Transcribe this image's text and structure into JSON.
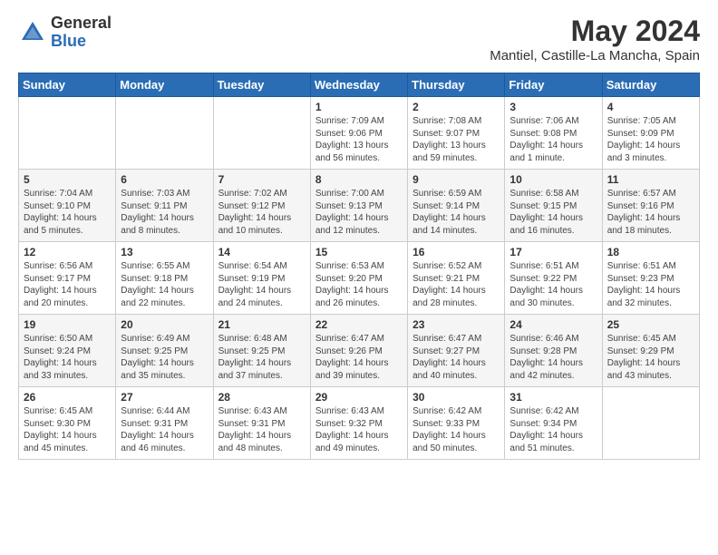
{
  "header": {
    "logo_general": "General",
    "logo_blue": "Blue",
    "main_title": "May 2024",
    "subtitle": "Mantiel, Castille-La Mancha, Spain"
  },
  "columns": [
    "Sunday",
    "Monday",
    "Tuesday",
    "Wednesday",
    "Thursday",
    "Friday",
    "Saturday"
  ],
  "weeks": [
    [
      {
        "day": "",
        "sunrise": "",
        "sunset": "",
        "daylight": ""
      },
      {
        "day": "",
        "sunrise": "",
        "sunset": "",
        "daylight": ""
      },
      {
        "day": "",
        "sunrise": "",
        "sunset": "",
        "daylight": ""
      },
      {
        "day": "1",
        "sunrise": "Sunrise: 7:09 AM",
        "sunset": "Sunset: 9:06 PM",
        "daylight": "Daylight: 13 hours and 56 minutes."
      },
      {
        "day": "2",
        "sunrise": "Sunrise: 7:08 AM",
        "sunset": "Sunset: 9:07 PM",
        "daylight": "Daylight: 13 hours and 59 minutes."
      },
      {
        "day": "3",
        "sunrise": "Sunrise: 7:06 AM",
        "sunset": "Sunset: 9:08 PM",
        "daylight": "Daylight: 14 hours and 1 minute."
      },
      {
        "day": "4",
        "sunrise": "Sunrise: 7:05 AM",
        "sunset": "Sunset: 9:09 PM",
        "daylight": "Daylight: 14 hours and 3 minutes."
      }
    ],
    [
      {
        "day": "5",
        "sunrise": "Sunrise: 7:04 AM",
        "sunset": "Sunset: 9:10 PM",
        "daylight": "Daylight: 14 hours and 5 minutes."
      },
      {
        "day": "6",
        "sunrise": "Sunrise: 7:03 AM",
        "sunset": "Sunset: 9:11 PM",
        "daylight": "Daylight: 14 hours and 8 minutes."
      },
      {
        "day": "7",
        "sunrise": "Sunrise: 7:02 AM",
        "sunset": "Sunset: 9:12 PM",
        "daylight": "Daylight: 14 hours and 10 minutes."
      },
      {
        "day": "8",
        "sunrise": "Sunrise: 7:00 AM",
        "sunset": "Sunset: 9:13 PM",
        "daylight": "Daylight: 14 hours and 12 minutes."
      },
      {
        "day": "9",
        "sunrise": "Sunrise: 6:59 AM",
        "sunset": "Sunset: 9:14 PM",
        "daylight": "Daylight: 14 hours and 14 minutes."
      },
      {
        "day": "10",
        "sunrise": "Sunrise: 6:58 AM",
        "sunset": "Sunset: 9:15 PM",
        "daylight": "Daylight: 14 hours and 16 minutes."
      },
      {
        "day": "11",
        "sunrise": "Sunrise: 6:57 AM",
        "sunset": "Sunset: 9:16 PM",
        "daylight": "Daylight: 14 hours and 18 minutes."
      }
    ],
    [
      {
        "day": "12",
        "sunrise": "Sunrise: 6:56 AM",
        "sunset": "Sunset: 9:17 PM",
        "daylight": "Daylight: 14 hours and 20 minutes."
      },
      {
        "day": "13",
        "sunrise": "Sunrise: 6:55 AM",
        "sunset": "Sunset: 9:18 PM",
        "daylight": "Daylight: 14 hours and 22 minutes."
      },
      {
        "day": "14",
        "sunrise": "Sunrise: 6:54 AM",
        "sunset": "Sunset: 9:19 PM",
        "daylight": "Daylight: 14 hours and 24 minutes."
      },
      {
        "day": "15",
        "sunrise": "Sunrise: 6:53 AM",
        "sunset": "Sunset: 9:20 PM",
        "daylight": "Daylight: 14 hours and 26 minutes."
      },
      {
        "day": "16",
        "sunrise": "Sunrise: 6:52 AM",
        "sunset": "Sunset: 9:21 PM",
        "daylight": "Daylight: 14 hours and 28 minutes."
      },
      {
        "day": "17",
        "sunrise": "Sunrise: 6:51 AM",
        "sunset": "Sunset: 9:22 PM",
        "daylight": "Daylight: 14 hours and 30 minutes."
      },
      {
        "day": "18",
        "sunrise": "Sunrise: 6:51 AM",
        "sunset": "Sunset: 9:23 PM",
        "daylight": "Daylight: 14 hours and 32 minutes."
      }
    ],
    [
      {
        "day": "19",
        "sunrise": "Sunrise: 6:50 AM",
        "sunset": "Sunset: 9:24 PM",
        "daylight": "Daylight: 14 hours and 33 minutes."
      },
      {
        "day": "20",
        "sunrise": "Sunrise: 6:49 AM",
        "sunset": "Sunset: 9:25 PM",
        "daylight": "Daylight: 14 hours and 35 minutes."
      },
      {
        "day": "21",
        "sunrise": "Sunrise: 6:48 AM",
        "sunset": "Sunset: 9:25 PM",
        "daylight": "Daylight: 14 hours and 37 minutes."
      },
      {
        "day": "22",
        "sunrise": "Sunrise: 6:47 AM",
        "sunset": "Sunset: 9:26 PM",
        "daylight": "Daylight: 14 hours and 39 minutes."
      },
      {
        "day": "23",
        "sunrise": "Sunrise: 6:47 AM",
        "sunset": "Sunset: 9:27 PM",
        "daylight": "Daylight: 14 hours and 40 minutes."
      },
      {
        "day": "24",
        "sunrise": "Sunrise: 6:46 AM",
        "sunset": "Sunset: 9:28 PM",
        "daylight": "Daylight: 14 hours and 42 minutes."
      },
      {
        "day": "25",
        "sunrise": "Sunrise: 6:45 AM",
        "sunset": "Sunset: 9:29 PM",
        "daylight": "Daylight: 14 hours and 43 minutes."
      }
    ],
    [
      {
        "day": "26",
        "sunrise": "Sunrise: 6:45 AM",
        "sunset": "Sunset: 9:30 PM",
        "daylight": "Daylight: 14 hours and 45 minutes."
      },
      {
        "day": "27",
        "sunrise": "Sunrise: 6:44 AM",
        "sunset": "Sunset: 9:31 PM",
        "daylight": "Daylight: 14 hours and 46 minutes."
      },
      {
        "day": "28",
        "sunrise": "Sunrise: 6:43 AM",
        "sunset": "Sunset: 9:31 PM",
        "daylight": "Daylight: 14 hours and 48 minutes."
      },
      {
        "day": "29",
        "sunrise": "Sunrise: 6:43 AM",
        "sunset": "Sunset: 9:32 PM",
        "daylight": "Daylight: 14 hours and 49 minutes."
      },
      {
        "day": "30",
        "sunrise": "Sunrise: 6:42 AM",
        "sunset": "Sunset: 9:33 PM",
        "daylight": "Daylight: 14 hours and 50 minutes."
      },
      {
        "day": "31",
        "sunrise": "Sunrise: 6:42 AM",
        "sunset": "Sunset: 9:34 PM",
        "daylight": "Daylight: 14 hours and 51 minutes."
      },
      {
        "day": "",
        "sunrise": "",
        "sunset": "",
        "daylight": ""
      }
    ]
  ]
}
